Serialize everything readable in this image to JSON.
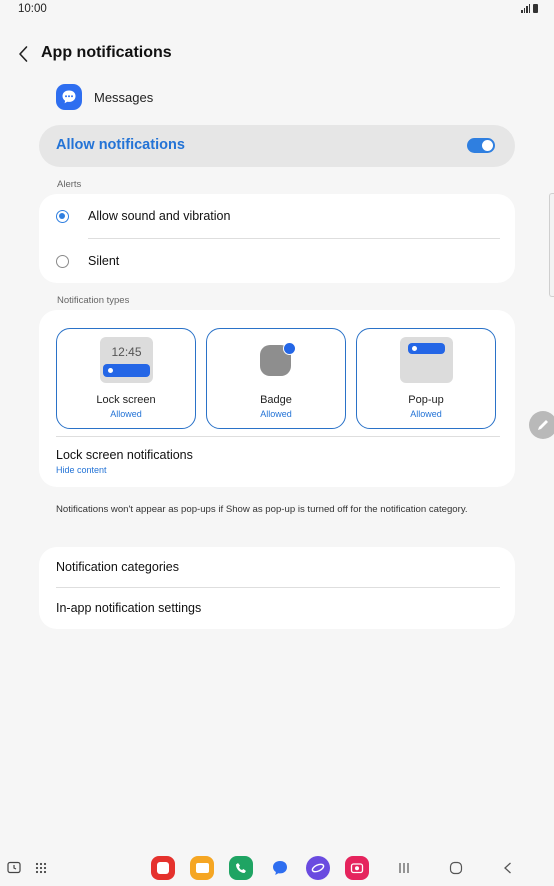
{
  "status_bar": {
    "time": "10:00"
  },
  "header": {
    "title": "App notifications"
  },
  "app": {
    "name": "Messages"
  },
  "allow": {
    "label": "Allow notifications",
    "enabled": true
  },
  "alerts": {
    "section_label": "Alerts",
    "options": [
      {
        "label": "Allow sound and vibration",
        "selected": true
      },
      {
        "label": "Silent",
        "selected": false
      }
    ]
  },
  "types": {
    "section_label": "Notification types",
    "items": [
      {
        "title": "Lock screen",
        "status": "Allowed",
        "preview_time": "12:45"
      },
      {
        "title": "Badge",
        "status": "Allowed"
      },
      {
        "title": "Pop-up",
        "status": "Allowed"
      }
    ],
    "lock_screen": {
      "title": "Lock screen notifications",
      "value": "Hide content"
    }
  },
  "info": {
    "text": "Notifications won't appear as pop-ups if Show as pop-up is turned off for the notification category."
  },
  "more": {
    "items": [
      "Notification categories",
      "In-app notification settings"
    ]
  },
  "colors": {
    "accent": "#2373d6",
    "toggle": "#2f7fe0",
    "background": "#f6f6f6",
    "card": "#ffffff"
  }
}
